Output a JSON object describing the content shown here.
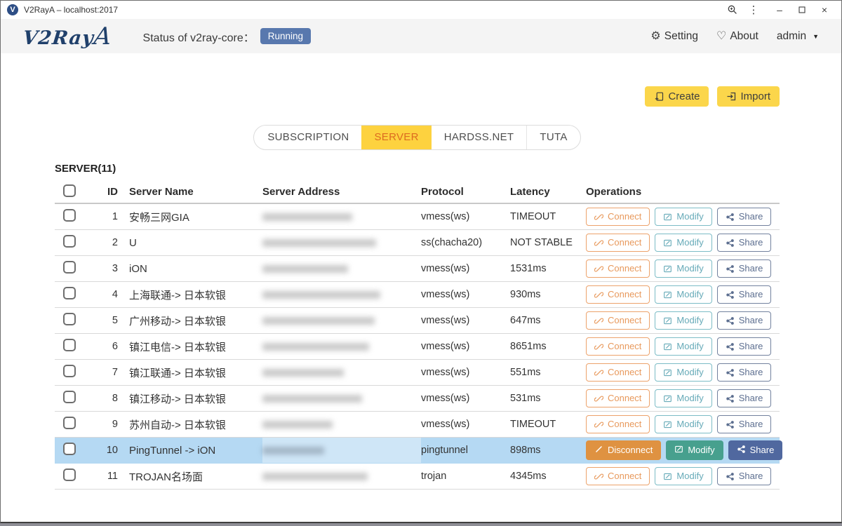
{
  "window": {
    "title": "V2RayA – localhost:2017",
    "app_initial": "V"
  },
  "header": {
    "logo_text": "V2Ray",
    "logo_text_a": "A",
    "status_label": "Status of v2ray-core：",
    "status_badge": "Running",
    "setting_label": "Setting",
    "about_label": "About",
    "user_menu": "admin"
  },
  "toolbar": {
    "create_label": "Create",
    "import_label": "Import"
  },
  "tabs": {
    "items": [
      {
        "label": "SUBSCRIPTION",
        "active": false
      },
      {
        "label": "SERVER",
        "active": true
      },
      {
        "label": "HARDSS.NET",
        "active": false
      },
      {
        "label": "TUTA",
        "active": false
      }
    ]
  },
  "table": {
    "title": "SERVER(11)",
    "columns": [
      "ID",
      "Server Name",
      "Server Address",
      "Protocol",
      "Latency",
      "Operations"
    ],
    "actions": {
      "connect": "Connect",
      "disconnect": "Disconnect",
      "modify": "Modify",
      "share": "Share"
    },
    "rows": [
      {
        "id": "1",
        "name": "安畅三网GIA",
        "address_redacted": true,
        "address_mask_width": 128,
        "protocol": "vmess(ws)",
        "latency": "TIMEOUT",
        "connected": false
      },
      {
        "id": "2",
        "name": "U",
        "address_redacted": true,
        "address_mask_width": 162,
        "protocol": "ss(chacha20)",
        "latency": "NOT STABLE",
        "connected": false
      },
      {
        "id": "3",
        "name": "iON",
        "address_redacted": true,
        "address_mask_width": 122,
        "protocol": "vmess(ws)",
        "latency": "1531ms",
        "connected": false
      },
      {
        "id": "4",
        "name": "上海联通-> 日本软银",
        "address_redacted": true,
        "address_mask_width": 168,
        "protocol": "vmess(ws)",
        "latency": "930ms",
        "connected": false
      },
      {
        "id": "5",
        "name": "广州移动-> 日本软银",
        "address_redacted": true,
        "address_mask_width": 160,
        "protocol": "vmess(ws)",
        "latency": "647ms",
        "connected": false
      },
      {
        "id": "6",
        "name": "镇江电信-> 日本软银",
        "address_redacted": true,
        "address_mask_width": 152,
        "protocol": "vmess(ws)",
        "latency": "8651ms",
        "connected": false
      },
      {
        "id": "7",
        "name": "镇江联通-> 日本软银",
        "address_redacted": true,
        "address_mask_width": 116,
        "protocol": "vmess(ws)",
        "latency": "551ms",
        "connected": false
      },
      {
        "id": "8",
        "name": "镇江移动-> 日本软银",
        "address_redacted": true,
        "address_mask_width": 142,
        "protocol": "vmess(ws)",
        "latency": "531ms",
        "connected": false
      },
      {
        "id": "9",
        "name": "苏州自动-> 日本软银",
        "address_redacted": true,
        "address_mask_width": 100,
        "protocol": "vmess(ws)",
        "latency": "TIMEOUT",
        "connected": false
      },
      {
        "id": "10",
        "name": "PingTunnel -> iON",
        "address_redacted": true,
        "address_mask_width": 88,
        "protocol": "pingtunnel",
        "latency": "898ms",
        "connected": true
      },
      {
        "id": "11",
        "name": "TROJAN名场面",
        "address_redacted": true,
        "address_mask_width": 150,
        "protocol": "trojan",
        "latency": "4345ms",
        "connected": false
      }
    ]
  },
  "colors": {
    "accent_yellow": "#fbd64b",
    "active_tab_bg": "#fdd23f",
    "active_tab_text": "#dd6b20",
    "running_badge_bg": "#5878ae",
    "row_highlight_bg": "#b5d9f3",
    "connect_orange": "#e8995c",
    "modify_teal": "#66aab8",
    "share_slate": "#5d6f90",
    "disconnect_filled_bg": "#df9241",
    "modify_filled_bg": "#47a08e",
    "share_filled_bg": "#50689f",
    "logo_navy": "#20406b"
  }
}
